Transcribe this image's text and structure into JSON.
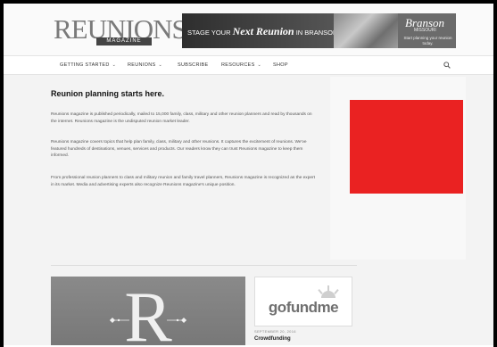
{
  "header": {
    "logo_text": "REUNIONS",
    "logo_sub": "MAGAZINE",
    "banner": {
      "prefix": "STAGE YOUR",
      "highlight": "Next Reunion",
      "suffix": "IN BRANSON.",
      "brand": "Branson",
      "brand_sub": "MISSOURI",
      "cta": "Start planning your reunion today."
    }
  },
  "nav": {
    "items": [
      {
        "label": "GETTING STARTED",
        "dropdown": true
      },
      {
        "label": "REUNIONS",
        "dropdown": true
      },
      {
        "label": "SUBSCRIBE",
        "dropdown": false
      },
      {
        "label": "RESOURCES",
        "dropdown": true
      },
      {
        "label": "SHOP",
        "dropdown": false
      }
    ],
    "chevron": "⌄"
  },
  "main": {
    "title": "Reunion planning starts here.",
    "paragraphs": [
      "Reunions magazine is published periodically, mailed to 15,000 family, class, military and other reunion planners and read by thousands on the internet. Reunions magazine is the undisputed reunion market leader.",
      "Reunions magazine covers topics that help plan family, class, military and other reunions. It captures the excitement of reunions. We've featured hundreds of destinations, venues, services and products. Our readers know they can trust Reunions magazine to keep them informed.",
      "From professional reunion planners to class and military reunion and family travel planners, Reunions magazine is recognized as the expert in its market. Media and advertising experts also recognize Reunions magazine's unique position."
    ]
  },
  "sidebar": {
    "ad_color": "#ea2222"
  },
  "feature": {
    "letter": "R"
  },
  "post": {
    "logo_text": "gofundme",
    "date": "SEPTEMBER 20, 2016",
    "title": "Crowdfunding"
  },
  "icons": {
    "search": "search-icon"
  }
}
